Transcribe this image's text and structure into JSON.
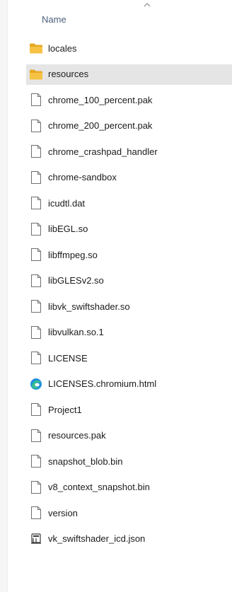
{
  "header": {
    "name_label": "Name"
  },
  "files": [
    {
      "name": "locales",
      "icon": "folder-icon",
      "selected": false
    },
    {
      "name": "resources",
      "icon": "folder-icon",
      "selected": true
    },
    {
      "name": "chrome_100_percent.pak",
      "icon": "file-icon",
      "selected": false
    },
    {
      "name": "chrome_200_percent.pak",
      "icon": "file-icon",
      "selected": false
    },
    {
      "name": "chrome_crashpad_handler",
      "icon": "file-icon",
      "selected": false
    },
    {
      "name": "chrome-sandbox",
      "icon": "file-icon",
      "selected": false
    },
    {
      "name": "icudtl.dat",
      "icon": "file-icon",
      "selected": false
    },
    {
      "name": "libEGL.so",
      "icon": "file-icon",
      "selected": false
    },
    {
      "name": "libffmpeg.so",
      "icon": "file-icon",
      "selected": false
    },
    {
      "name": "libGLESv2.so",
      "icon": "file-icon",
      "selected": false
    },
    {
      "name": "libvk_swiftshader.so",
      "icon": "file-icon",
      "selected": false
    },
    {
      "name": "libvulkan.so.1",
      "icon": "file-icon",
      "selected": false
    },
    {
      "name": "LICENSE",
      "icon": "file-icon",
      "selected": false
    },
    {
      "name": "LICENSES.chromium.html",
      "icon": "edge-browser-icon",
      "selected": false
    },
    {
      "name": "Project1",
      "icon": "file-icon",
      "selected": false
    },
    {
      "name": "resources.pak",
      "icon": "file-icon",
      "selected": false
    },
    {
      "name": "snapshot_blob.bin",
      "icon": "file-icon",
      "selected": false
    },
    {
      "name": "v8_context_snapshot.bin",
      "icon": "file-icon",
      "selected": false
    },
    {
      "name": "version",
      "icon": "file-icon",
      "selected": false
    },
    {
      "name": "vk_swiftshader_icd.json",
      "icon": "json-file-icon",
      "selected": false
    }
  ],
  "colors": {
    "folder": "#f6c244",
    "folder_dark": "#e5a823",
    "selection": "#e5e5e5",
    "header_text": "#4c607a"
  }
}
